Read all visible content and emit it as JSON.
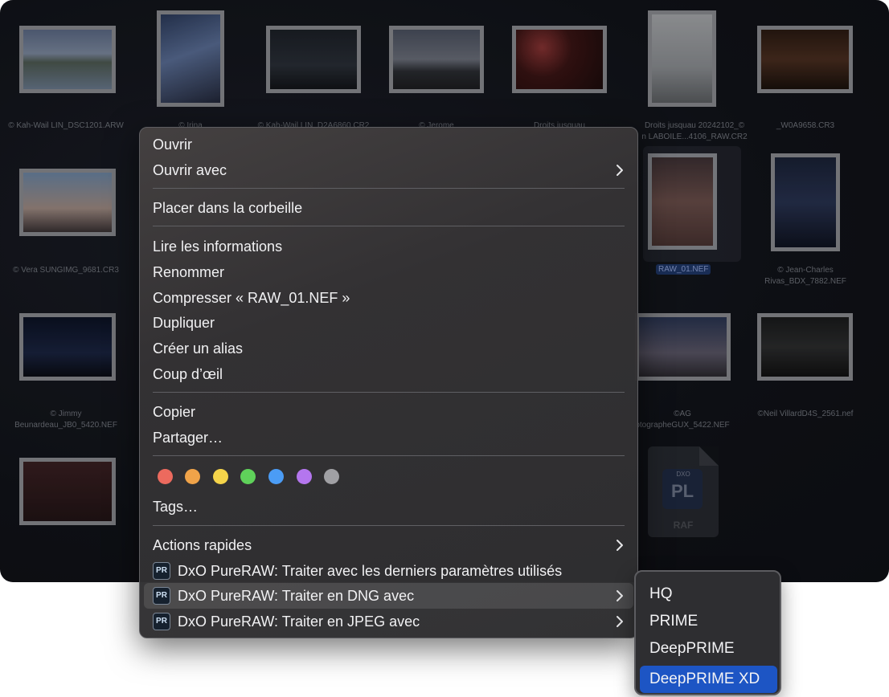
{
  "files": [
    {
      "caption": "© Kah-Wail LIN_DSC1201.ARW"
    },
    {
      "caption": "© Irina"
    },
    {
      "caption": "© Kah-Wail LIN_D2A6860.CR2"
    },
    {
      "caption": "© Jerome"
    },
    {
      "caption": "Droits jusquau"
    },
    {
      "caption": "Droits jusquau 20242102_©",
      "caption2": "n LABOILE...4106_RAW.CR2"
    },
    {
      "caption": "_W0A9658.CR3"
    },
    {
      "caption": "© Vera SUNGIMG_9681.CR3"
    },
    {
      "caption": "RAW_01.NEF"
    },
    {
      "caption": "© Jean-Charles",
      "caption2": "Rivas_BDX_7882.NEF"
    },
    {
      "caption": "© Jimmy",
      "caption2": "Beunardeau_JB0_5420.NEF"
    },
    {
      "caption": "©AG",
      "caption2": "otographeGUX_5422.NEF"
    },
    {
      "caption": "©Neil VillardD4S_2561.nef"
    }
  ],
  "doc_icon": {
    "badge": "PL",
    "brand": "DXO",
    "ext": "RAF"
  },
  "menu": {
    "open": "Ouvrir",
    "open_with": "Ouvrir avec",
    "trash": "Placer dans la corbeille",
    "get_info": "Lire les informations",
    "rename": "Renommer",
    "compress": "Compresser « RAW_01.NEF »",
    "duplicate": "Dupliquer",
    "alias": "Créer un alias",
    "quicklook": "Coup d’œil",
    "copy": "Copier",
    "share": "Partager…",
    "tags": "Tags…",
    "quick_actions": "Actions rapides",
    "pr_icon_text": "PR",
    "pr_last": "DxO PureRAW: Traiter avec les derniers paramètres utilisés",
    "pr_dng": "DxO PureRAW: Traiter en DNG avec",
    "pr_jpeg": "DxO PureRAW: Traiter en JPEG avec",
    "tag_colors": [
      "#ec6a5e",
      "#f0a349",
      "#f5d44a",
      "#5fd15a",
      "#4b9cf5",
      "#b476ee",
      "#a0a0a4"
    ]
  },
  "submenu": {
    "items": [
      "HQ",
      "PRIME",
      "DeepPRIME",
      "DeepPRIME XD"
    ],
    "selected": "DeepPRIME XD"
  }
}
